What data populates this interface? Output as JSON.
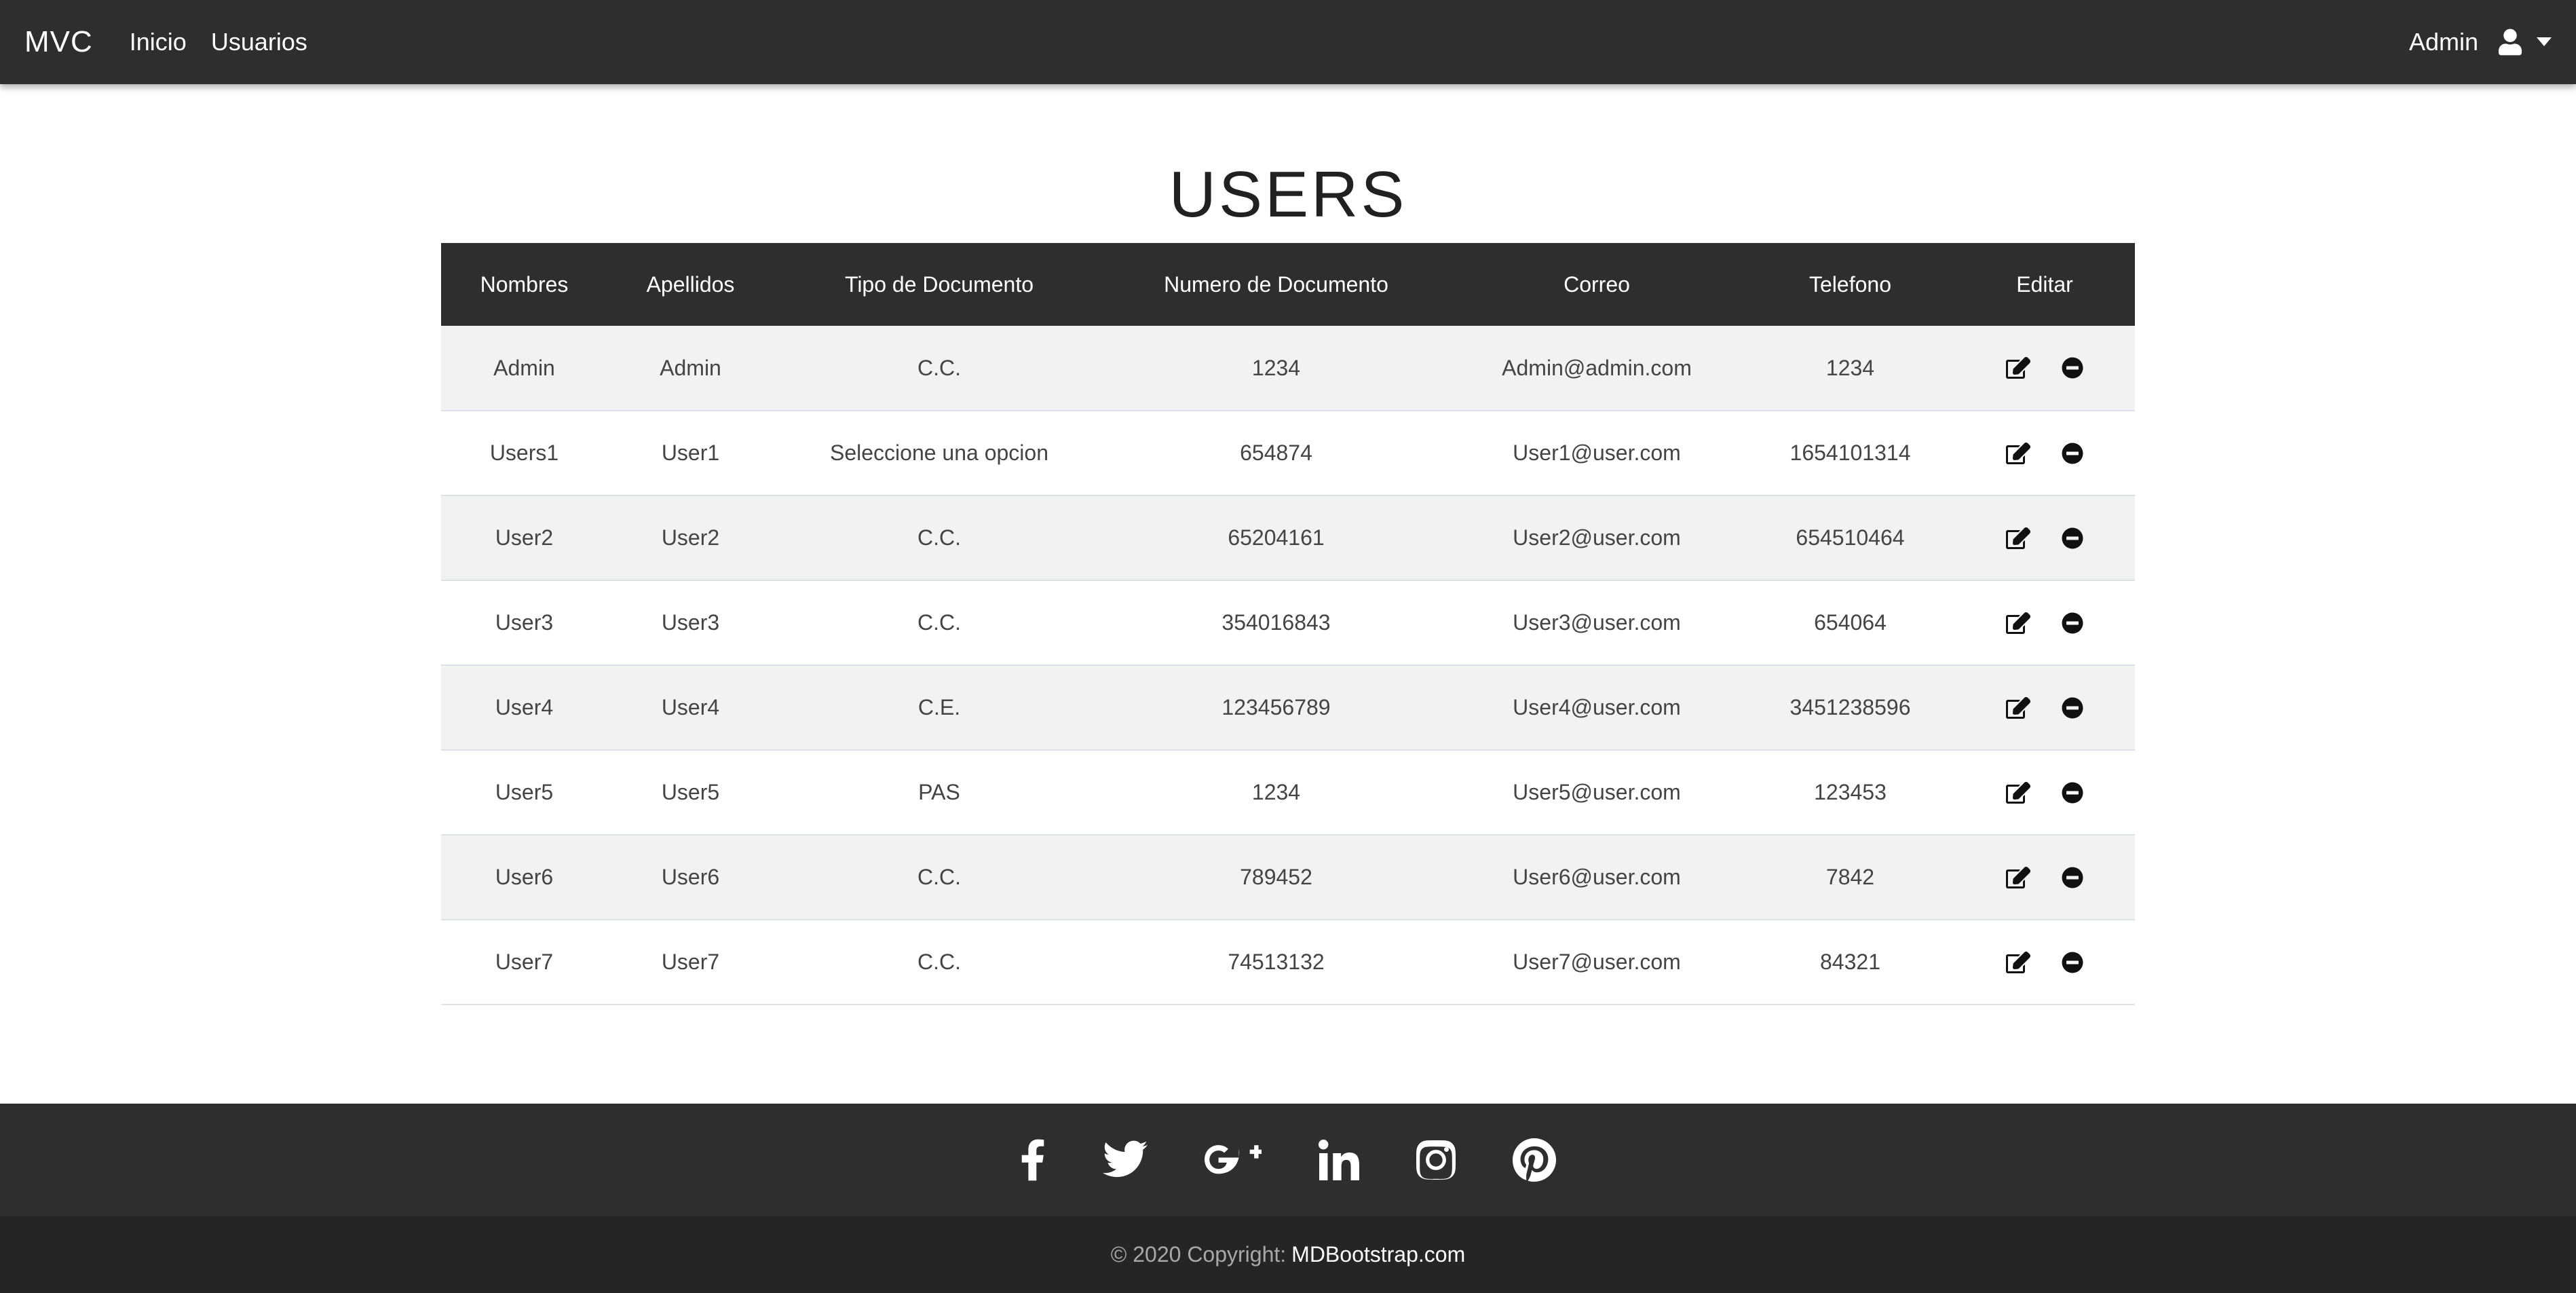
{
  "navbar": {
    "brand": "MVC",
    "links": [
      {
        "label": "Inicio"
      },
      {
        "label": "Usuarios"
      }
    ],
    "user_label": "Admin"
  },
  "page": {
    "title": "USERS"
  },
  "table": {
    "headers": [
      "Nombres",
      "Apellidos",
      "Tipo de Documento",
      "Numero de Documento",
      "Correo",
      "Telefono",
      "Editar"
    ],
    "rows": [
      [
        "Admin",
        "Admin",
        "C.C.",
        "1234",
        "Admin@admin.com",
        "1234"
      ],
      [
        "Users1",
        "User1",
        "Seleccione una opcion",
        "654874",
        "User1@user.com",
        "1654101314"
      ],
      [
        "User2",
        "User2",
        "C.C.",
        "65204161",
        "User2@user.com",
        "654510464"
      ],
      [
        "User3",
        "User3",
        "C.C.",
        "354016843",
        "User3@user.com",
        "654064"
      ],
      [
        "User4",
        "User4",
        "C.E.",
        "123456789",
        "User4@user.com",
        "3451238596"
      ],
      [
        "User5",
        "User5",
        "PAS",
        "1234",
        "User5@user.com",
        "123453"
      ],
      [
        "User6",
        "User6",
        "C.C.",
        "789452",
        "User6@user.com",
        "7842"
      ],
      [
        "User7",
        "User7",
        "C.C.",
        "74513132",
        "User7@user.com",
        "84321"
      ]
    ],
    "row_actions": [
      "edit-icon",
      "remove-circle-icon"
    ]
  },
  "footer": {
    "social_icons": [
      "facebook-icon",
      "twitter-icon",
      "google-plus-icon",
      "linkedin-icon",
      "instagram-icon",
      "pinterest-icon"
    ],
    "copyright_prefix": "© 2020 Copyright:",
    "copyright_link": "MDBootstrap.com"
  },
  "colors": {
    "navbar_bg": "#2e2e2e",
    "table_header_bg": "#2e2e2e",
    "stripe_bg": "#f2f2f2",
    "footer_bg": "#2e2e2e",
    "footer_copy_bg": "#252525"
  }
}
